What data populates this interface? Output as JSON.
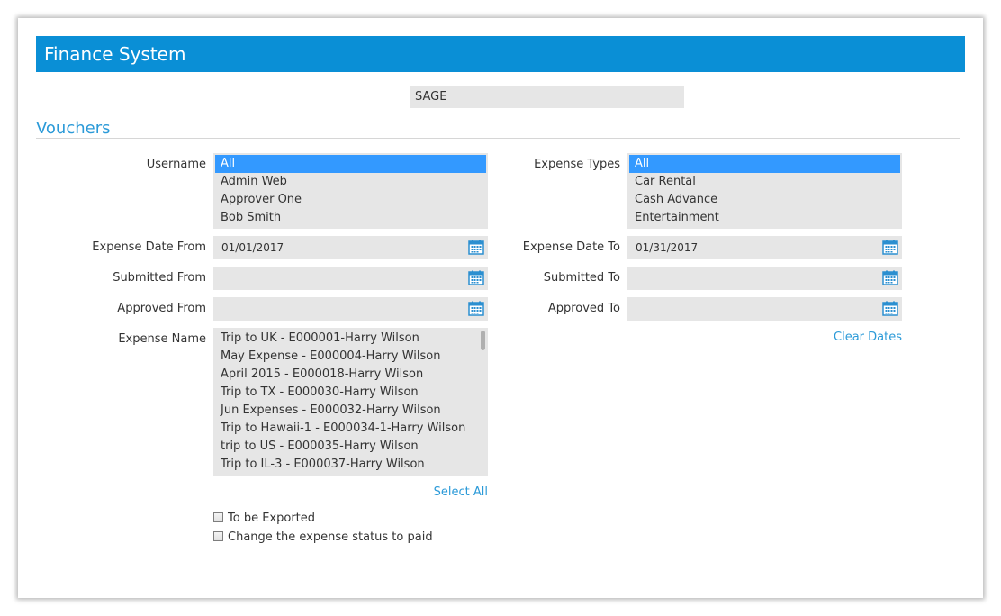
{
  "header": {
    "title": "Finance System"
  },
  "company": {
    "value": "SAGE"
  },
  "section": {
    "title": "Vouchers"
  },
  "username": {
    "label": "Username",
    "options": [
      "All",
      "Admin Web",
      "Approver One",
      "Bob Smith"
    ],
    "selected": "All"
  },
  "expense_types": {
    "label": "Expense Types",
    "options": [
      "All",
      "Car Rental",
      "Cash Advance",
      "Entertainment"
    ],
    "selected": "All"
  },
  "dates": {
    "expense_from": {
      "label": "Expense Date From",
      "value": "01/01/2017"
    },
    "expense_to": {
      "label": "Expense Date To",
      "value": "01/31/2017"
    },
    "submitted_from": {
      "label": "Submitted From",
      "value": ""
    },
    "submitted_to": {
      "label": "Submitted To",
      "value": ""
    },
    "approved_from": {
      "label": "Approved From",
      "value": ""
    },
    "approved_to": {
      "label": "Approved To",
      "value": ""
    },
    "icon": "calendar-icon"
  },
  "clear_dates": {
    "label": "Clear Dates"
  },
  "expense_name": {
    "label": "Expense Name",
    "options": [
      "Trip to UK - E000001-Harry Wilson",
      "May Expense - E000004-Harry Wilson",
      "April 2015 - E000018-Harry Wilson",
      "Trip to TX - E000030-Harry Wilson",
      "Jun Expenses - E000032-Harry Wilson",
      "Trip to Hawaii-1 - E000034-1-Harry Wilson",
      "trip to US - E000035-Harry Wilson",
      "Trip to IL-3 - E000037-Harry Wilson"
    ]
  },
  "select_all": {
    "label": "Select All"
  },
  "checkboxes": {
    "to_be_exported": {
      "label": "To be Exported",
      "checked": false
    },
    "change_status_paid": {
      "label": "Change the expense status to paid",
      "checked": false
    }
  },
  "colors": {
    "header_bg": "#0a8fd6",
    "accent": "#2b9ad8",
    "selection": "#3399ff",
    "field_bg": "#e6e6e6"
  }
}
